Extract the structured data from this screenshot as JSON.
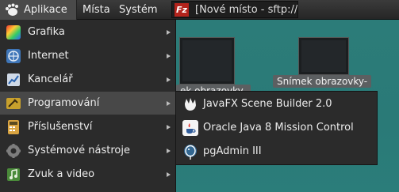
{
  "panel": {
    "apps_menu_label": "Aplikace",
    "places_label": "Místa",
    "system_label": "Systém",
    "task_title": "[Nové místo - sftp://v..."
  },
  "desktop": {
    "thumb1_label": "ek obrazovky-",
    "thumb2_label": "Snímek obrazovky-"
  },
  "main_menu": {
    "items": [
      {
        "label": "Grafika",
        "icon": "graphics-icon"
      },
      {
        "label": "Internet",
        "icon": "internet-icon"
      },
      {
        "label": "Kancelář",
        "icon": "office-icon"
      },
      {
        "label": "Programování",
        "icon": "programming-icon"
      },
      {
        "label": "Příslušenství",
        "icon": "accessories-icon"
      },
      {
        "label": "Systémové nástroje",
        "icon": "system-tools-icon"
      },
      {
        "label": "Zvuk a video",
        "icon": "sound-video-icon"
      }
    ],
    "active_index": 3
  },
  "sub_menu": {
    "items": [
      {
        "label": "JavaFX Scene Builder 2.0",
        "icon": "javafx-icon"
      },
      {
        "label": "Oracle Java 8 Mission Control",
        "icon": "java-icon"
      },
      {
        "label": "pgAdmin III",
        "icon": "pgadmin-icon"
      }
    ]
  },
  "colors": {
    "desktop": "#2b7c79",
    "menu_bg": "#2b2b2b",
    "active_bg": "#484848",
    "filezilla": "#b3231c"
  }
}
